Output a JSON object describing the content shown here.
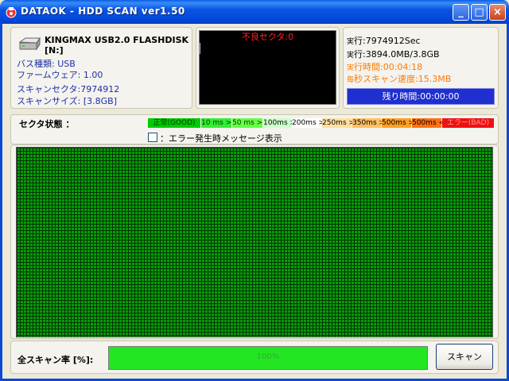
{
  "window": {
    "title": "DATAOK - HDD SCAN ver1.50",
    "buttons": {
      "minimize": "_",
      "maximize": "□",
      "close": "×"
    }
  },
  "device": {
    "name": "KINGMAX USB2.0 FLASHDISK [N:]",
    "bus_type": "バス種類: USB",
    "firmware": "ファームウェア: 1.00",
    "scan_sector": "スキャンセクタ:7974912",
    "scan_size": "スキャンサイズ: [3.8GB]"
  },
  "log": {
    "bad_sector": "不良セクタ:0"
  },
  "stats": {
    "exec_sector": {
      "k": "実",
      "v": "行:7974912Sec"
    },
    "exec_size": {
      "k": "実",
      "v": "行:3894.0MB/3.8GB"
    },
    "exec_time": {
      "k": "実",
      "v": "行時間:00:04:18"
    },
    "speed": {
      "k": "毎",
      "v": "秒スキャン速度:15.3MB"
    },
    "remaining": "残り時間:00:00:00"
  },
  "legend": {
    "title": "セクタ状態 ：",
    "items": [
      {
        "label": "正常(GOOD)",
        "color": "#00cc00",
        "text_color": "#003300"
      },
      {
        "label": "10 ms >",
        "color": "#33ee33",
        "text_color": "#003300"
      },
      {
        "label": "50 ms >",
        "color": "#66ff44",
        "text_color": "#003300"
      },
      {
        "label": "100ms >",
        "color": "#ccffcc",
        "text_color": "#000000"
      },
      {
        "label": "200ms >",
        "color": "#ffffff",
        "text_color": "#000000"
      },
      {
        "label": "250ms >",
        "color": "#ffe0a0",
        "text_color": "#000000"
      },
      {
        "label": "350ms >",
        "color": "#ffc060",
        "text_color": "#000000"
      },
      {
        "label": "500ms >",
        "color": "#ffa020",
        "text_color": "#000000"
      },
      {
        "label": "500ms <",
        "color": "#ff7010",
        "text_color": "#000000"
      },
      {
        "label": "エラー(BAD)",
        "color": "#ee1111",
        "text_color": "#ff9999"
      }
    ]
  },
  "error_message_checkbox": {
    "label": "：エラー発生時メッセージ表示",
    "checked": false
  },
  "progress": {
    "label": "全スキャン率 [%]:",
    "value": 100,
    "text": "100%"
  },
  "scan_button": {
    "label": "スキャン"
  },
  "colors": {
    "title_bar": "#0a54e3",
    "grid_good": "#00a000",
    "remain_box": "#1f2fd0"
  }
}
